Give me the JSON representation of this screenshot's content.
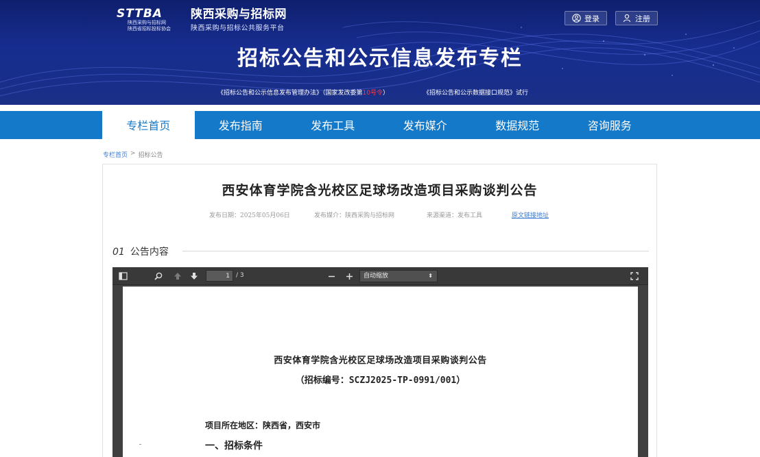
{
  "header": {
    "logo_mark": "STTBA",
    "logo_sub1": "陕西采购与招标网",
    "logo_sub2": "陕西省招标投标协会",
    "site_name": "陕西采购与招标网",
    "site_subtitle": "陕西采购与招标公共服务平台",
    "login_label": "登录",
    "register_label": "注册",
    "banner_title": "招标公告和公示信息发布专栏",
    "link1_pre": "《招标公告和公示信息发布管理办法》（国家发改委第",
    "link1_red": "10号令",
    "link1_post": "）",
    "link2": "《招标公告和公示数据接口规范》试行"
  },
  "nav": {
    "items": [
      "专栏首页",
      "发布指南",
      "发布工具",
      "发布媒介",
      "数据规范",
      "咨询服务"
    ],
    "active_index": 0
  },
  "breadcrumb": {
    "home": "专栏首页",
    "separator": ">",
    "current": "招标公告"
  },
  "article": {
    "title": "西安体育学院含光校区足球场改造项目采购谈判公告",
    "publish_date": "发布日期：2025年05月06日",
    "media": "发布媒介：陕西采购与招标网",
    "source": "来源渠道：发布工具",
    "original_link": "原文链接地址",
    "section_num": "01",
    "section_label": "公告内容"
  },
  "viewer": {
    "page_value": "1",
    "page_total": "/ 3",
    "zoom_label": "自动缩放",
    "icons": [
      "sidebar-toggle-icon",
      "search-icon",
      "previous-page-icon",
      "next-page-icon",
      "zoom-out-icon",
      "zoom-in-icon",
      "fullscreen-icon"
    ]
  },
  "pdf": {
    "title": "西安体育学院含光校区足球场改造项目采购谈判公告",
    "code": "（招标编号：SCZJ2025-TP-0991/001）",
    "location": "项目所在地区：陕西省，西安市",
    "heading1": "一、招标条件"
  },
  "colors": {
    "banner": "#172d8f",
    "nav": "#1479c8",
    "link": "#3a7bd5",
    "highlight_red": "#ff3a3a",
    "viewer_dark": "#404040"
  }
}
